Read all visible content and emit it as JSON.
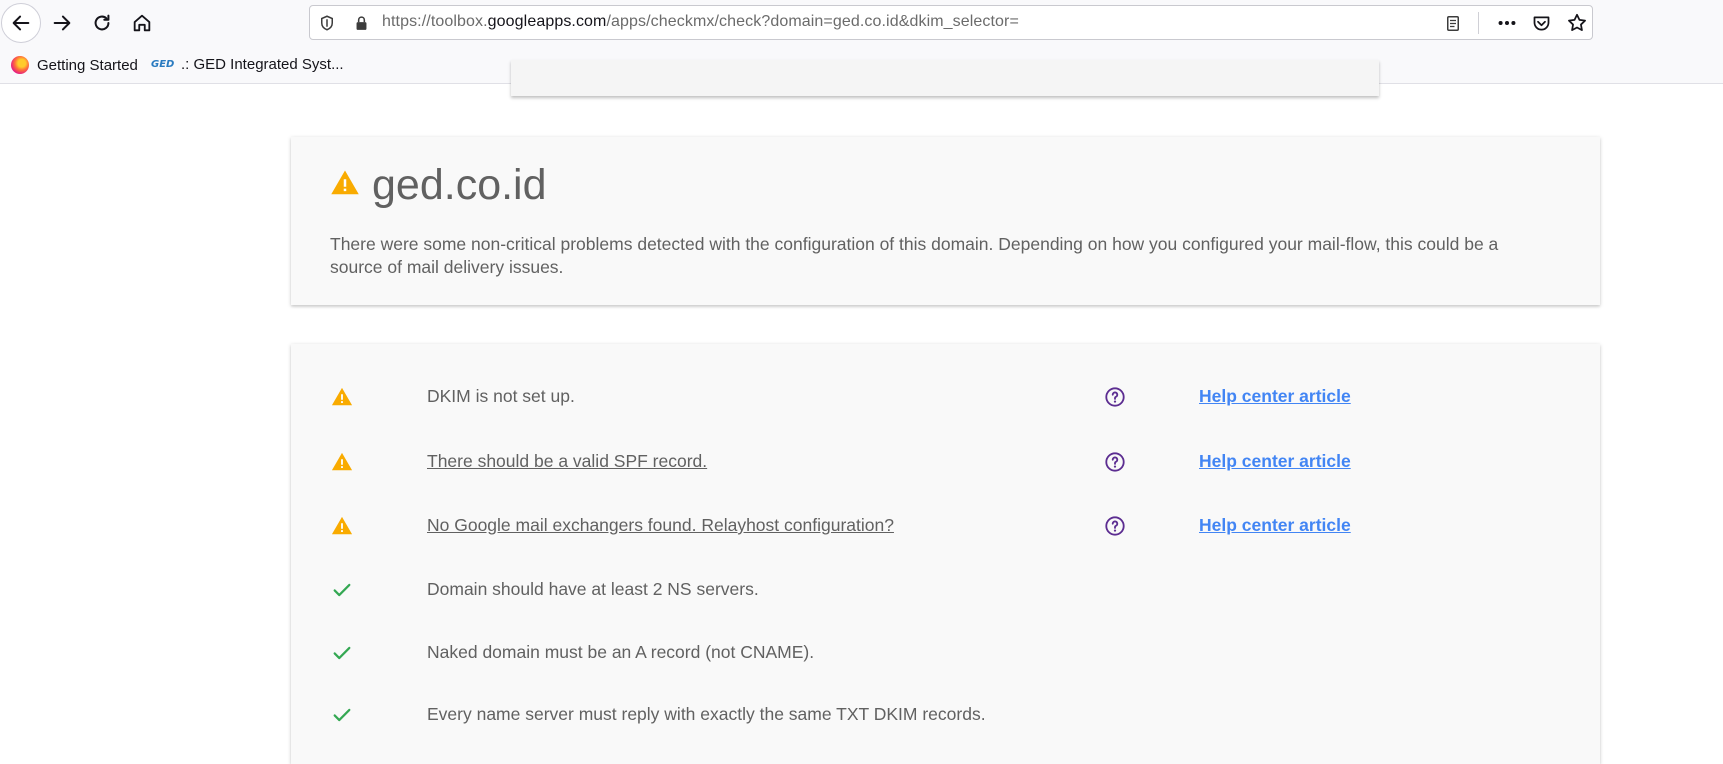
{
  "browser": {
    "url": {
      "scheme": "https://toolbox.",
      "host": "googleapps.com",
      "path": "/apps/checkmx/check?domain=ged.co.id&dkim_selector="
    },
    "bookmarks": [
      {
        "label": "Getting Started",
        "icon": "firefox-icon"
      },
      {
        "label": ".: GED Integrated Syst...",
        "icon": "ged-logo"
      }
    ]
  },
  "summary": {
    "status_icon": "warning-icon",
    "domain": "ged.co.id",
    "description": "There were some non-critical problems detected with the configuration of this domain. Depending on how you configured your mail-flow, this could be a source of mail delivery issues."
  },
  "checks": [
    {
      "status": "warning",
      "message": "DKIM is not set up.",
      "link": false,
      "help_article": "Help center article"
    },
    {
      "status": "warning",
      "message": "There should be a valid SPF record.",
      "link": true,
      "help_article": "Help center article"
    },
    {
      "status": "warning",
      "message": "No Google mail exchangers found. Relayhost configuration?",
      "link": true,
      "help_article": "Help center article"
    },
    {
      "status": "ok",
      "message": "Domain should have at least 2 NS servers.",
      "link": false,
      "help_article": ""
    },
    {
      "status": "ok",
      "message": "Naked domain must be an A record (not CNAME).",
      "link": false,
      "help_article": ""
    },
    {
      "status": "ok",
      "message": "Every name server must reply with exactly the same TXT DKIM records.",
      "link": false,
      "help_article": ""
    }
  ],
  "colors": {
    "warning": "#f9ab00",
    "ok": "#34a853",
    "help": "#5c2d91",
    "link": "#4285f4"
  }
}
